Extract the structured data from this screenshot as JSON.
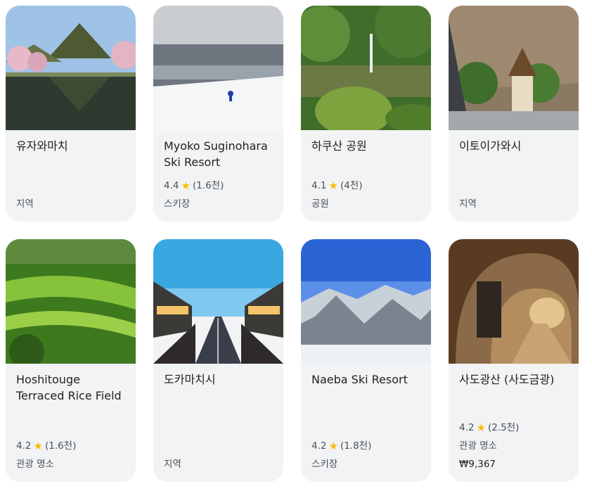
{
  "cards": [
    {
      "title": "유자와마치",
      "category": "지역"
    },
    {
      "title": "Myoko Suginohara Ski Resort",
      "rating": "4.4",
      "reviews": "(1.6천)",
      "category": "스키장"
    },
    {
      "title": "하쿠산 공원",
      "rating": "4.1",
      "reviews": "(4천)",
      "category": "공원"
    },
    {
      "title": "이토이가와시",
      "category": "지역"
    },
    {
      "title": "Hoshitouge Terraced Rice Field",
      "rating": "4.2",
      "reviews": "(1.6천)",
      "category": "관광 명소"
    },
    {
      "title": "도카마치시",
      "category": "지역"
    },
    {
      "title": "Naeba Ski Resort",
      "rating": "4.2",
      "reviews": "(1.8천)",
      "category": "스키장"
    },
    {
      "title": "사도광산 (사도금광)",
      "rating": "4.2",
      "reviews": "(2.5천)",
      "category": "관광 명소",
      "price": "₩9,367"
    }
  ],
  "colors": {
    "card_bg": "#f1f3f4",
    "star": "#fbbc04",
    "text": "#202124",
    "muted": "#4d5156"
  }
}
